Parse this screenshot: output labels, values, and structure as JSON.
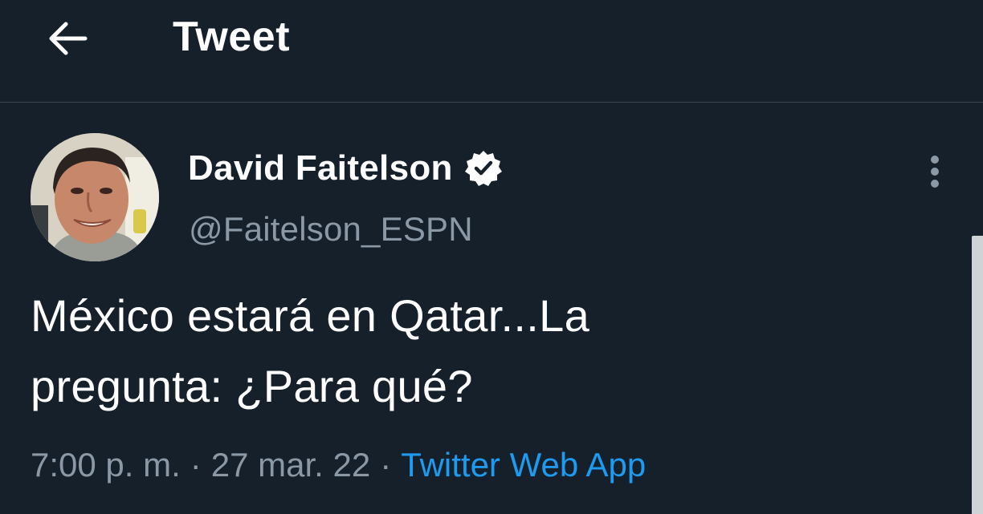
{
  "header": {
    "title": "Tweet",
    "back_icon": "arrow-left-icon"
  },
  "tweet": {
    "author": {
      "display_name": "David Faitelson",
      "handle": "@Faitelson_ESPN",
      "verified": true,
      "verified_icon": "verified-badge-icon"
    },
    "text_line1": "México estará en Qatar...La",
    "text_line2": "pregunta: ¿Para qué?",
    "time": "7:00 p. m.",
    "separator": "·",
    "date": "27 mar. 22",
    "source": "Twitter Web App",
    "more_icon": "more-vertical-icon"
  },
  "colors": {
    "background": "#15202b",
    "text": "#ffffff",
    "secondary_text": "#8b98a5",
    "link": "#1d9bf0",
    "divider": "#38444d"
  }
}
